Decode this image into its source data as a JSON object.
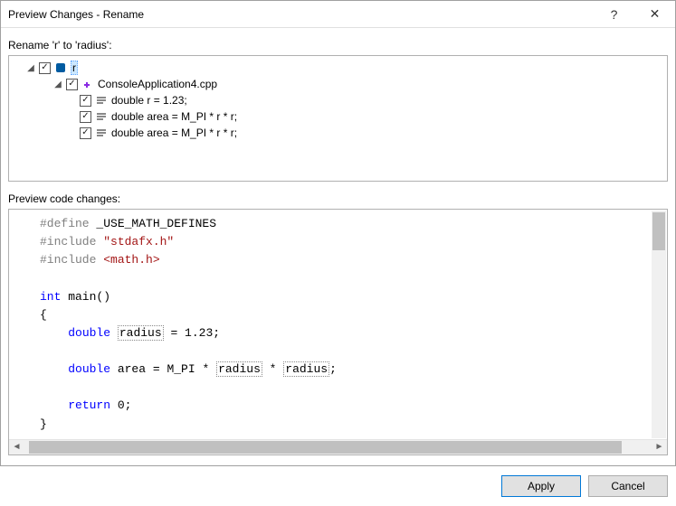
{
  "window": {
    "title": "Preview Changes - Rename",
    "help_icon": "?",
    "close_icon": "✕"
  },
  "header_label": "Rename 'r' to 'radius':",
  "tree": {
    "root": {
      "label": "r"
    },
    "file": {
      "label": "ConsoleApplication4.cpp"
    },
    "lines": [
      {
        "label": "double r = 1.23;"
      },
      {
        "label": "double area = M_PI * r * r;"
      },
      {
        "label": "double area = M_PI * r * r;"
      }
    ]
  },
  "preview_label": "Preview code changes:",
  "code": {
    "l1_pp": "#define",
    "l1_rest": " _USE_MATH_DEFINES",
    "l2_pp": "#include",
    "l2_str": " \"stdafx.h\"",
    "l3_pp": "#include",
    "l3_str": " <math.h>",
    "l5_type": "int",
    "l5_name": " main()",
    "l8_type": "double",
    "l8_var": "radius",
    "l8_rest": " = 1.23;",
    "l10_type": "double",
    "l10_mid": " area = M_PI * ",
    "l10_v1": "radius",
    "l10_sep": " * ",
    "l10_v2": "radius",
    "l10_end": ";",
    "l12_kw": "return",
    "l12_rest": " 0;"
  },
  "buttons": {
    "apply": "Apply",
    "cancel": "Cancel"
  }
}
